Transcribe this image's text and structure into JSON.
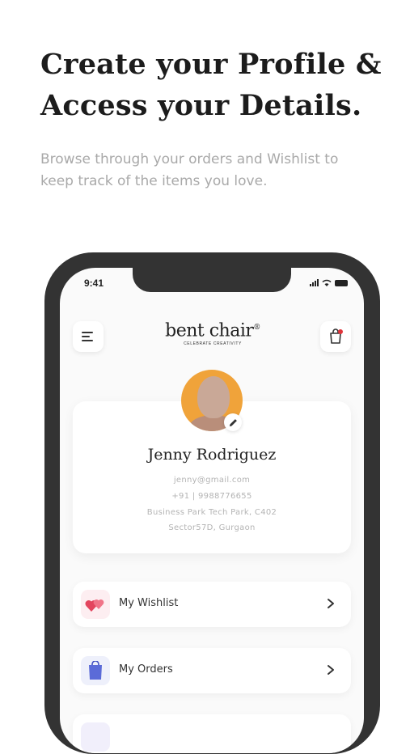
{
  "header": {
    "headline_line1": "Create your Profile &",
    "headline_line2": "Access your Details.",
    "subtitle_line1": "Browse through your orders and Wishlist to",
    "subtitle_line2": "keep track of the items you love."
  },
  "status_bar": {
    "time": "9:41",
    "icons": [
      "signal-icon",
      "wifi-icon",
      "battery-icon"
    ]
  },
  "app_bar": {
    "logo_text": "bent chair",
    "logo_mark": "®",
    "logo_tagline": "CELEBRATE CREATIVITY",
    "menu_icon": "hamburger-menu-icon",
    "cart_icon": "shopping-bag-icon",
    "cart_badge_color": "#e0343b"
  },
  "profile": {
    "name": "Jenny Rodriguez",
    "email": "jenny@gmail.com",
    "phone": "+91 | 9988776655",
    "address_line1": "Business Park Tech Park, C402",
    "address_line2": "Sector57D, Gurgaon",
    "edit_icon": "pencil-icon",
    "avatar_bg": "#f0a33a"
  },
  "menu": {
    "items": [
      {
        "label": "My Wishlist",
        "icon": "hearts-icon",
        "icon_color": "#e3455e"
      },
      {
        "label": "My Orders",
        "icon": "shopping-bag-icon",
        "icon_color": "#5b6bd8"
      }
    ]
  }
}
